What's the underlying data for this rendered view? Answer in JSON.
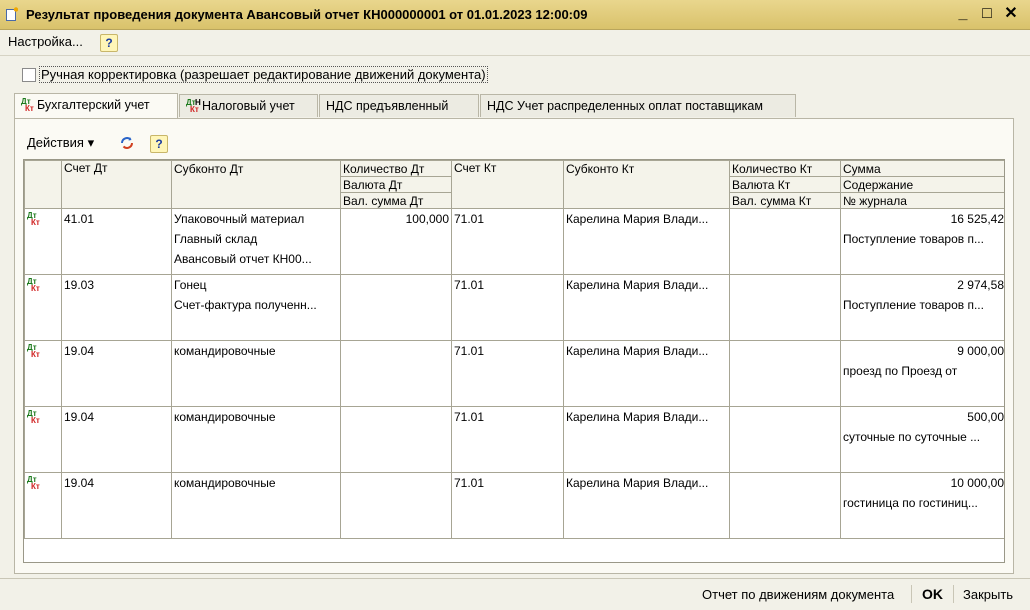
{
  "window": {
    "title": "Результат проведения документа Авансовый отчет КН000000001 от 01.01.2023 12:00:09",
    "minimize_glyph": "_",
    "maximize_glyph": "□",
    "close_glyph": "✕"
  },
  "menu": {
    "settings_label": "Настройка...",
    "help_glyph": "?"
  },
  "manual_edit": {
    "checked": false,
    "label": "Ручная корректировка (разрешает редактирование движений документа)"
  },
  "tabs": [
    {
      "label": "Бухгалтерский учет",
      "icon": "dt-kt-icon",
      "active": true
    },
    {
      "label": "Налоговый учет",
      "icon": "dt-kt-tax-icon",
      "active": false
    },
    {
      "label": "НДС предъявленный",
      "active": false
    },
    {
      "label": "НДС Учет распределенных оплат поставщикам",
      "active": false
    }
  ],
  "toolbar": {
    "actions_label": "Действия",
    "actions_arrow": "▾",
    "help_glyph": "?"
  },
  "grid": {
    "headers": {
      "debit_account": "Счет Дт",
      "debit_subconto": "Субконто Дт",
      "debit_qty": "Количество Дт",
      "debit_currency": "Валюта Дт",
      "debit_currency_sum": "Вал. сумма Дт",
      "credit_account": "Счет Кт",
      "credit_subconto": "Субконто Кт",
      "credit_qty": "Количество Кт",
      "credit_currency": "Валюта Кт",
      "credit_currency_sum": "Вал. сумма Кт",
      "amount": "Сумма",
      "content": "Содержание",
      "journal": "№ журнала"
    },
    "rows": [
      {
        "dt": "41.01",
        "sub_dt": [
          "Упаковочный материал",
          "Главный склад",
          "Авансовый отчет КН00..."
        ],
        "qty_dt": "100,000",
        "kt": "71.01",
        "sub_kt": "Карелина Мария Влади...",
        "sum": "16 525,42",
        "content": "Поступление товаров п..."
      },
      {
        "dt": "19.03",
        "sub_dt": [
          "Гонец",
          "Счет-фактура полученн..."
        ],
        "qty_dt": "",
        "kt": "71.01",
        "sub_kt": "Карелина Мария Влади...",
        "sum": "2 974,58",
        "content": "Поступление товаров п..."
      },
      {
        "dt": "19.04",
        "sub_dt": [
          "командировочные"
        ],
        "qty_dt": "",
        "kt": "71.01",
        "sub_kt": "Карелина Мария Влади...",
        "sum": "9 000,00",
        "content": "проезд по Проезд  от"
      },
      {
        "dt": "19.04",
        "sub_dt": [
          "командировочные"
        ],
        "qty_dt": "",
        "kt": "71.01",
        "sub_kt": "Карелина Мария Влади...",
        "sum": "500,00",
        "content": "суточные по суточные  ..."
      },
      {
        "dt": "19.04",
        "sub_dt": [
          "командировочные"
        ],
        "qty_dt": "",
        "kt": "71.01",
        "sub_kt": "Карелина Мария Влади...",
        "sum": "10 000,00",
        "content": "гостиница по гостиниц..."
      }
    ]
  },
  "footer": {
    "report_label": "Отчет по движениям документа",
    "ok_label": "OK",
    "close_label": "Закрыть"
  },
  "icon_labels": {
    "dt": "Дт",
    "kt": "Кт",
    "tax": "Н"
  },
  "colors": {
    "titlebar": "#d9c26b",
    "dt_green": "#1c7a1c",
    "kt_red": "#d02020",
    "help_blue": "#1a3ca0"
  }
}
